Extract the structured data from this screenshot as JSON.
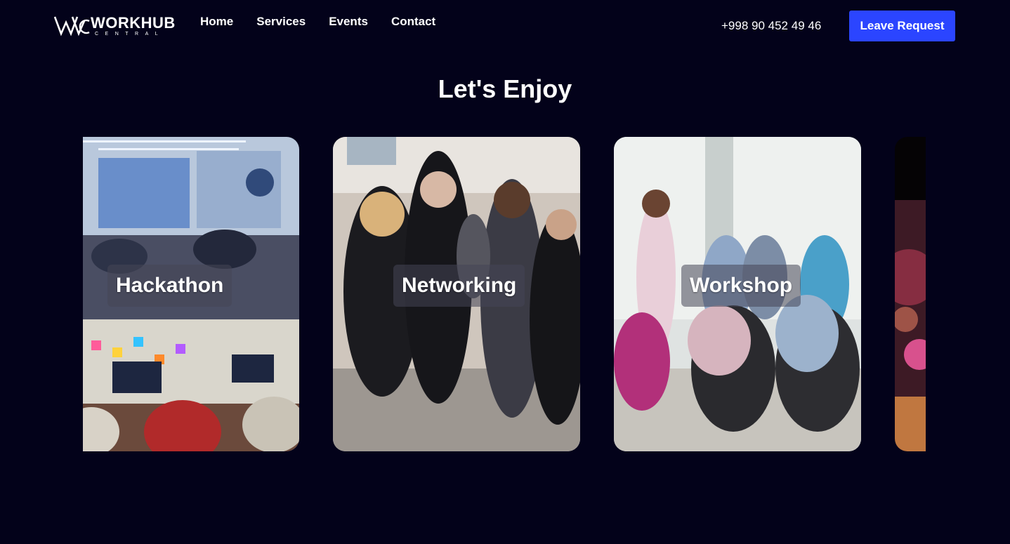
{
  "brand": {
    "name": "WORKHUB",
    "subtitle": "CENTRAL",
    "logo_icon": "wc-logo-icon"
  },
  "nav": {
    "items": [
      {
        "label": "Home"
      },
      {
        "label": "Services"
      },
      {
        "label": "Events"
      },
      {
        "label": "Contact"
      }
    ]
  },
  "header": {
    "phone": "+998 90 452 49 46",
    "cta_label": "Leave Request"
  },
  "section": {
    "title": "Let's Enjoy"
  },
  "events": [
    {
      "label": "Hackathon",
      "image": "hackathon-photo"
    },
    {
      "label": "Networking",
      "image": "networking-photo"
    },
    {
      "label": "Workshop",
      "image": "workshop-photo"
    },
    {
      "label": "",
      "image": "fireworks-photo"
    }
  ],
  "colors": {
    "background": "#03021a",
    "accent": "#2b45ff",
    "text": "#ffffff"
  }
}
